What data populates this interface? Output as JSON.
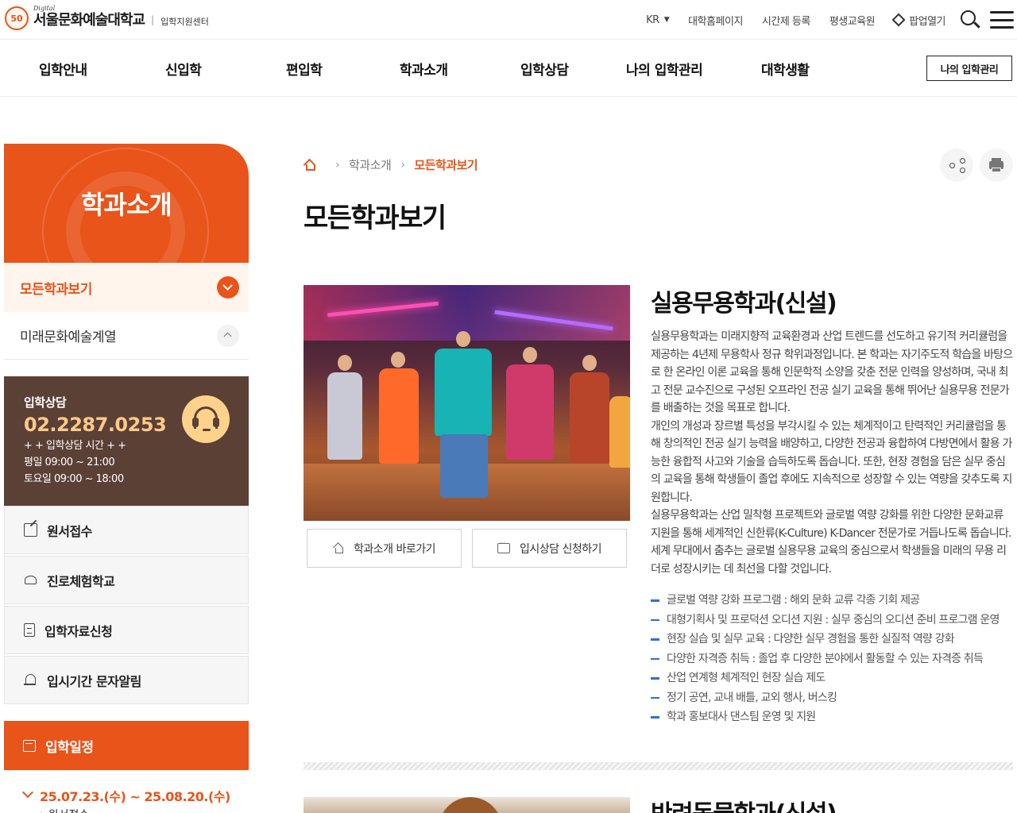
{
  "header": {
    "logo": {
      "emblem": "50",
      "digital": "Digital",
      "name": "서울문화예술대학교",
      "sep": "|",
      "sub": "입학지원센터"
    },
    "util": {
      "lang": "KR",
      "links": [
        "대학홈페이지",
        "시간제 등록",
        "평생교육원"
      ],
      "popup": "팝업열기"
    }
  },
  "gnb": {
    "items": [
      "입학안내",
      "신입학",
      "편입학",
      "학과소개",
      "입학상담",
      "나의 입학관리",
      "대학생활"
    ],
    "button": "나의 입학관리"
  },
  "sidebar": {
    "hero_title": "학과소개",
    "current": "모든학과보기",
    "sub": "미래문화예술계열",
    "consult": {
      "title": "입학상담",
      "phone": "02.2287.0253",
      "hours_title": "+ + 입학상담 시간 + +",
      "weekday": "평일 09:00 ~ 21:00",
      "saturday": "토요일 09:00 ~ 18:00"
    },
    "links": [
      "원서접수",
      "진로체험학교",
      "입학자료신청",
      "입시기간 문자알림"
    ],
    "schedule": {
      "label": "입학일정",
      "date": "25.07.23.(수) ~ 25.08.20.(수)",
      "next": "◦ 원서접수"
    }
  },
  "main": {
    "breadcrumb": [
      "학과소개",
      "모든학과보기"
    ],
    "page_title": "모든학과보기",
    "dept1": {
      "title": "실용무용학과(신설)",
      "paragraphs": [
        "실용무용학과는 미래지향적 교육환경과 산업 트렌드를 선도하고 유기적 커리큘럼을 제공하는 4년제 무용학사 정규 학위과정입니다. 본 학과는 자기주도적 학습을 바탕으로 한 온라인 이론 교육을 통해 인문학적 소양을 갖춘 전문 인력을 양성하며, 국내 최고 전문 교수진으로 구성된 오프라인 전공 실기 교육을 통해 뛰어난 실용무용 전문가를 배출하는 것을 목표로 합니다.",
        "개인의 개성과 장르별 특성을 부각시킬 수 있는 체계적이고 탄력적인 커리큘럼을 통해 창의적인 전공 실기 능력을 배양하고, 다양한 전공과 융합하여 다방면에서 활용 가능한 융합적 사고와 기술을 습득하도록 돕습니다. 또한, 현장 경험을 담은 실무 중심의 교육을 통해 학생들이 졸업 후에도 지속적으로 성장할 수 있는 역량을 갖추도록 지원합니다.",
        "실용무용학과는 산업 밀착형 프로젝트와 글로벌 역량 강화를 위한 다양한 문화교류 지원을 통해 세계적인 신한류(K-Culture) K-Dancer 전문가로 거듭나도록 돕습니다. 세계 무대에서 춤추는 글로벌 실용무용 교육의 중심으로서 학생들을 미래의 무용 리더로 성장시키는 데 최선을 다할 것입니다."
      ],
      "features": [
        "글로벌 역량 강화 프로그램 : 해외 문화 교류 각종 기회 제공",
        "대형기획사 및 프로덕션 오디션 지원 : 실무 중심의 오디션 준비 프로그램 운영",
        "현장 실습 및 실무 교육 : 다양한 실무 경험을 통한 실질적 역량 강화",
        "다양한 자격증 취득 : 졸업 후 다양한 분야에서 활동할 수 있는 자격증 취득",
        "산업 연계형 체계적인 현장 실습 제도",
        "정기 공연, 교내 배틀, 교외 행사, 버스킹",
        "학과 홍보대사 댄스팀 운영 및 지원"
      ],
      "btn_intro": "학과소개 바로가기",
      "btn_consult": "입시상담 신청하기"
    },
    "dept2": {
      "title": "반려동물학과(신설)"
    }
  }
}
